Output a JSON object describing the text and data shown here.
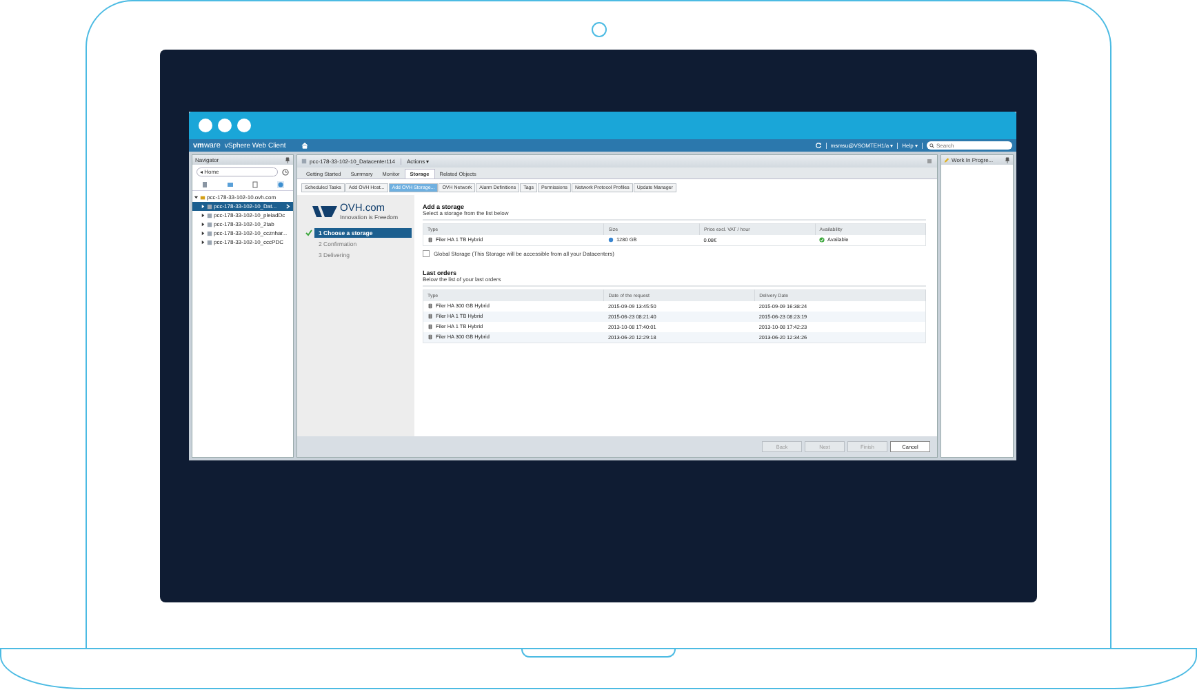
{
  "header": {
    "brand": "**vm**ware",
    "product": "vSphere Web Client",
    "user": "msmsu@VSOMTEH1/a ▾",
    "help": "Help ▾",
    "search": {
      "placeholder": "Search"
    }
  },
  "navigator": {
    "title": "Navigator",
    "history": "◂ Home",
    "tree": [
      {
        "label": "pcc-178-33-102-10.ovh.com",
        "expanded": true,
        "selected": false,
        "children": [
          {
            "label": "pcc-178-33-102-10_Dat...",
            "expanded": false,
            "selected": true
          },
          {
            "label": "pcc-178-33-102-10_pleiadDc",
            "expanded": false,
            "selected": false
          },
          {
            "label": "pcc-178-33-102-10_2tab",
            "expanded": false,
            "selected": false
          },
          {
            "label": "pcc-178-33-102-10_ccznhar...",
            "expanded": false,
            "selected": false
          },
          {
            "label": "pcc-178-33-102-10_cccPDC",
            "expanded": false,
            "selected": false
          }
        ]
      }
    ]
  },
  "main": {
    "object": "pcc-178-33-102-10_Datacenter114",
    "actions": "Actions ▾",
    "tabs": [
      {
        "label": "Getting Started",
        "selected": false
      },
      {
        "label": "Summary",
        "selected": false
      },
      {
        "label": "Monitor",
        "selected": false
      },
      {
        "label": "Storage",
        "selected": true
      },
      {
        "label": "Related Objects",
        "selected": false
      }
    ],
    "subtabs": [
      {
        "label": "Scheduled Tasks",
        "selected": false
      },
      {
        "label": "Add OVH Host...",
        "selected": false
      },
      {
        "label": "Add OVH Storage...",
        "selected": true
      },
      {
        "label": "OVH Network",
        "selected": false
      },
      {
        "label": "Alarm Definitions",
        "selected": false
      },
      {
        "label": "Tags",
        "selected": false
      },
      {
        "label": "Permissions",
        "selected": false
      },
      {
        "label": "Network Protocol Profiles",
        "selected": false
      },
      {
        "label": "Update Manager",
        "selected": false
      }
    ]
  },
  "wizard": {
    "logo": {
      "name": "OVH.com",
      "tagline": "Innovation is Freedom"
    },
    "steps": [
      {
        "label": "1 Choose a storage",
        "selected": true
      },
      {
        "label": "2 Confirmation",
        "selected": false
      },
      {
        "label": "3 Delivering",
        "selected": false
      }
    ],
    "add": {
      "title": "Add a storage",
      "subtitle": "Select a storage from the list below",
      "columns": [
        "Type",
        "Size",
        "Price excl. VAT / hour",
        "Availability"
      ],
      "rows": [
        {
          "type": "Filer HA 1 TB Hybrid",
          "size": "1280 GB",
          "price": "0.08€",
          "availability": "Available"
        }
      ],
      "global": {
        "label": "Global Storage (This Storage will be accessible from all your Datacenters)",
        "checked": false
      }
    },
    "orders": {
      "title": "Last orders",
      "subtitle": "Below the list of your last orders",
      "columns": [
        "Type",
        "Date of the request",
        "Delivery Date"
      ],
      "rows": [
        [
          "Filer HA 300 GB Hybrid",
          "2015-09-09 13:45:50",
          "2015-09-09 16:38:24"
        ],
        [
          "Filer HA 1 TB Hybrid",
          "2015-06-23 08:21:40",
          "2015-06-23 08:23:19"
        ],
        [
          "Filer HA 1 TB Hybrid",
          "2013-10-08 17:40:01",
          "2013-10-08 17:42:23"
        ],
        [
          "Filer HA 300 GB Hybrid",
          "2013-06-20 12:29:18",
          "2013-06-20 12:34:26"
        ]
      ]
    },
    "buttons": [
      {
        "label": "Back",
        "disabled": true
      },
      {
        "label": "Next",
        "disabled": true
      },
      {
        "label": "Finish",
        "disabled": true
      },
      {
        "label": "Cancel",
        "disabled": false
      }
    ]
  },
  "side": {
    "title": "Work In Progre..."
  }
}
